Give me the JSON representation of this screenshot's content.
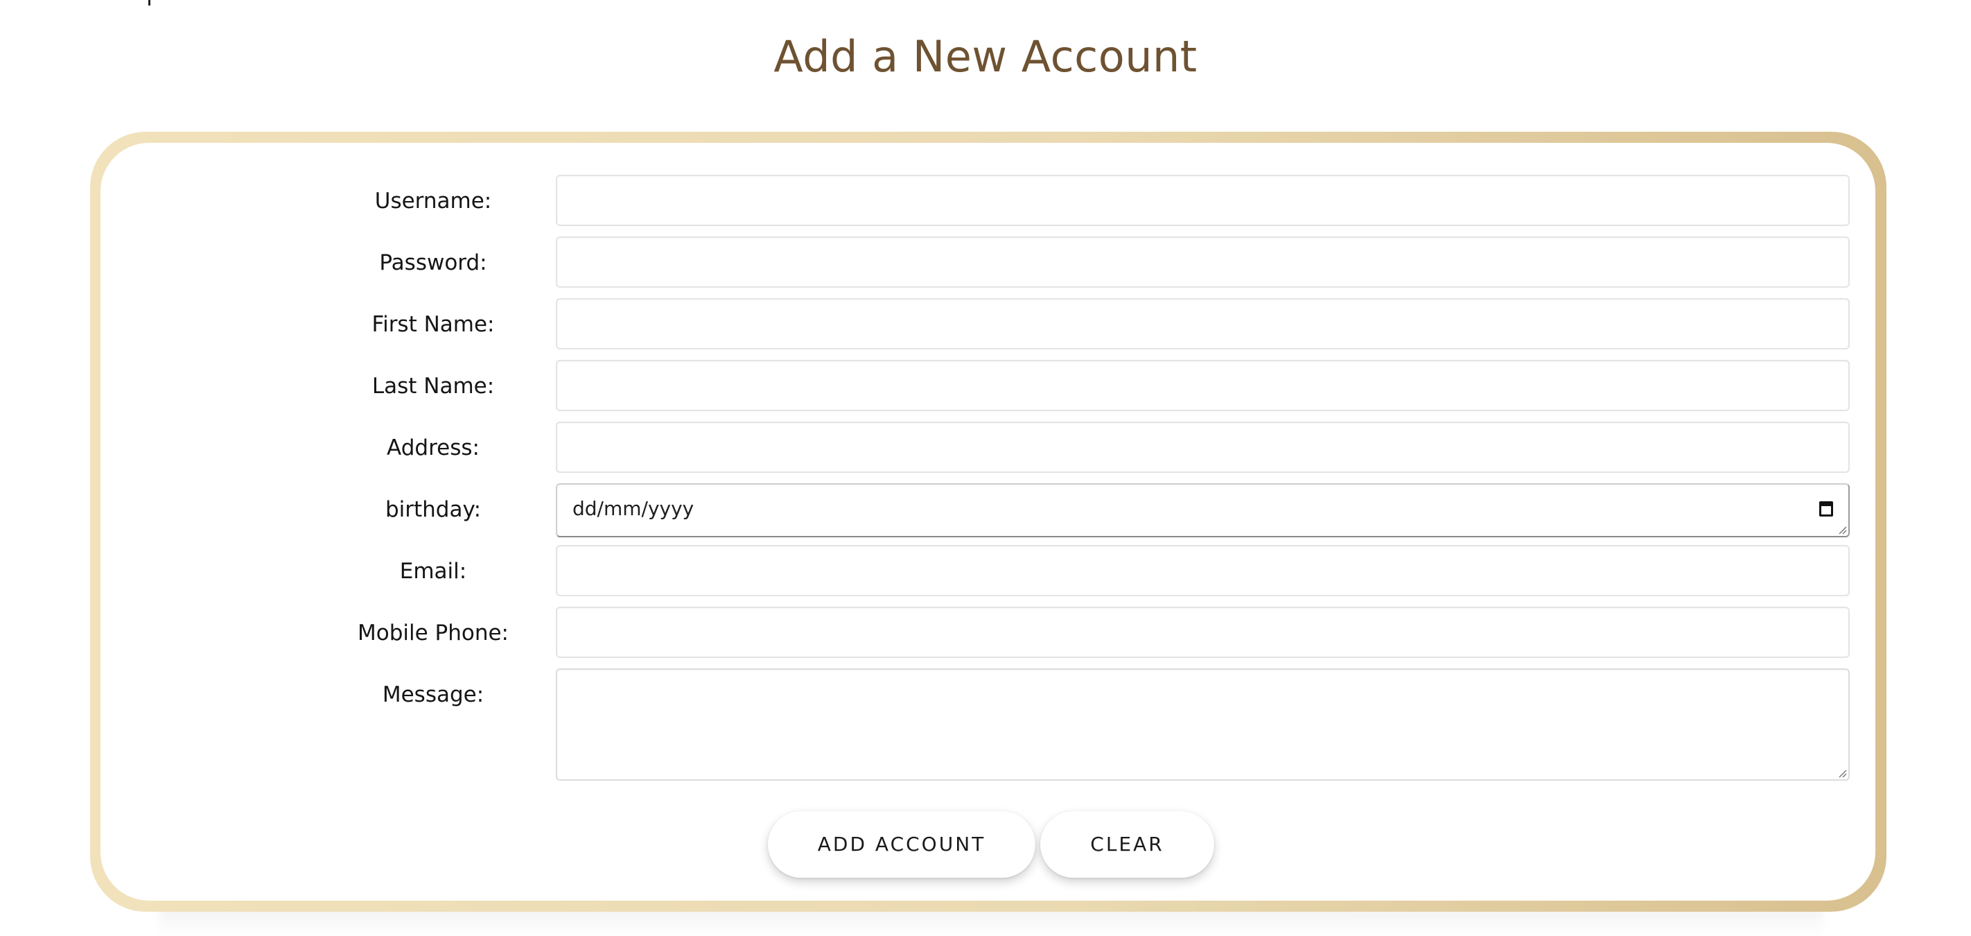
{
  "page": {
    "title": "Add a New Account"
  },
  "form": {
    "fields": [
      {
        "label": "Username:",
        "value": ""
      },
      {
        "label": "Password:",
        "value": ""
      },
      {
        "label": "First Name:",
        "value": ""
      },
      {
        "label": "Last Name:",
        "value": ""
      },
      {
        "label": "Address:",
        "value": ""
      },
      {
        "label": "birthday:",
        "placeholder": "dd/mm/yyyy",
        "value": ""
      },
      {
        "label": "Email:",
        "value": ""
      },
      {
        "label": "Mobile Phone:",
        "value": ""
      },
      {
        "label": "Message:",
        "value": ""
      }
    ],
    "buttons": {
      "add_label": "ADD ACCOUNT",
      "clear_label": "CLEAR"
    }
  },
  "icons": {
    "birthday_picker": "calendar-icon",
    "textarea_corner": "resize-handle-icon"
  },
  "colors": {
    "title": "#6e5231",
    "card_border_light": "#f1e2bc",
    "card_border_dark": "#d8c08f"
  }
}
